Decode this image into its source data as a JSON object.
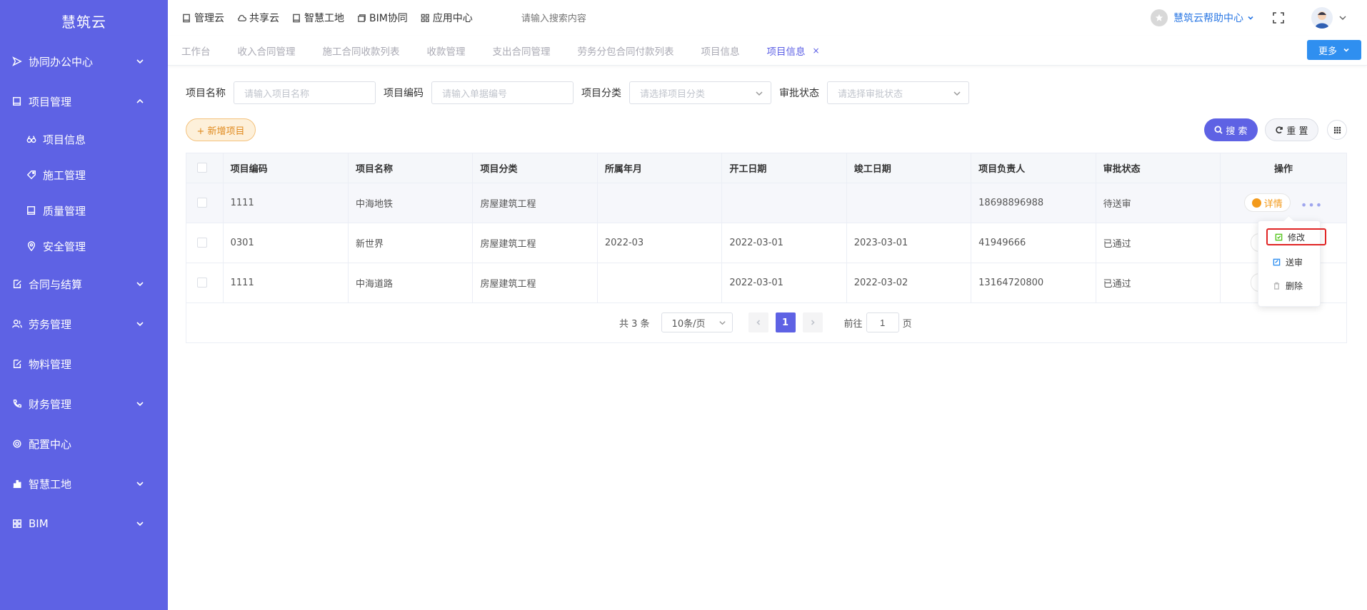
{
  "app": {
    "name": "慧筑云"
  },
  "sidebar": {
    "items": [
      {
        "label": "协同办公中心",
        "icon": "send-icon",
        "expandable": true,
        "expanded": false
      },
      {
        "label": "项目管理",
        "icon": "book-icon",
        "expandable": true,
        "expanded": true,
        "children": [
          {
            "label": "项目信息",
            "icon": "binoculars-icon"
          },
          {
            "label": "施工管理",
            "icon": "tag-icon"
          },
          {
            "label": "质量管理",
            "icon": "book-icon"
          },
          {
            "label": "安全管理",
            "icon": "location-icon"
          }
        ]
      },
      {
        "label": "合同与结算",
        "icon": "edit-icon",
        "expandable": true,
        "expanded": false
      },
      {
        "label": "劳务管理",
        "icon": "users-icon",
        "expandable": true,
        "expanded": false
      },
      {
        "label": "物料管理",
        "icon": "edit-icon",
        "expandable": false
      },
      {
        "label": "财务管理",
        "icon": "phone-icon",
        "expandable": true,
        "expanded": false
      },
      {
        "label": "配置中心",
        "icon": "gear-icon",
        "expandable": false
      },
      {
        "label": "智慧工地",
        "icon": "bar-chart-icon",
        "expandable": true,
        "expanded": false
      },
      {
        "label": "BIM",
        "icon": "grid-icon",
        "expandable": true,
        "expanded": false
      }
    ]
  },
  "topnav": {
    "items": [
      {
        "label": "管理云",
        "icon": "book-icon"
      },
      {
        "label": "共享云",
        "icon": "cloud-icon"
      },
      {
        "label": "智慧工地",
        "icon": "book-icon"
      },
      {
        "label": "BIM协同",
        "icon": "cube-icon"
      },
      {
        "label": "应用中心",
        "icon": "apps-icon"
      }
    ],
    "search_placeholder": "请输入搜索内容",
    "help_label": "慧筑云帮助中心"
  },
  "tabs": {
    "items": [
      "工作台",
      "收入合同管理",
      "施工合同收款列表",
      "收款管理",
      "支出合同管理",
      "劳务分包合同付款列表",
      "项目信息"
    ],
    "active": "项目信息",
    "close_symbol": "×",
    "more_label": "更多"
  },
  "filters": {
    "project_name": {
      "label": "项目名称",
      "placeholder": "请输入项目名称"
    },
    "project_code": {
      "label": "项目编码",
      "placeholder": "请输入单据编号"
    },
    "project_category": {
      "label": "项目分类",
      "placeholder": "请选择项目分类"
    },
    "approval_status": {
      "label": "审批状态",
      "placeholder": "请选择审批状态"
    }
  },
  "toolbar": {
    "add_label": "+ 新增项目",
    "search_label": "搜 索",
    "reset_label": "重 置"
  },
  "table": {
    "columns": [
      "项目编码",
      "项目名称",
      "项目分类",
      "所属年月",
      "开工日期",
      "竣工日期",
      "项目负责人",
      "审批状态",
      "操作"
    ],
    "rows": [
      {
        "code": "1111",
        "name": "中海地铁",
        "category": "房屋建筑工程",
        "month": "",
        "start": "",
        "end": "",
        "owner": "18698896988",
        "status": "待送审"
      },
      {
        "code": "0301",
        "name": "新世界",
        "category": "房屋建筑工程",
        "month": "2022-03",
        "start": "2022-03-01",
        "end": "2023-03-01",
        "owner": "41949666",
        "status": "已通过"
      },
      {
        "code": "1111",
        "name": "中海道路",
        "category": "房屋建筑工程",
        "month": "",
        "start": "2022-03-01",
        "end": "2022-03-02",
        "owner": "13164720800",
        "status": "已通过"
      }
    ],
    "detail_label": "详情",
    "more_dots": "•••"
  },
  "dropdown": {
    "items": [
      {
        "label": "修改",
        "icon": "edit-icon",
        "color": "#52c41a"
      },
      {
        "label": "送审",
        "icon": "send-doc-icon",
        "color": "#2f8ff0"
      },
      {
        "label": "删除",
        "icon": "trash-icon",
        "color": "#bbbbbb"
      }
    ]
  },
  "pagination": {
    "total_text": "共 3 条",
    "page_size": "10条/页",
    "current_page": "1",
    "goto_label": "前往",
    "goto_value": "1",
    "page_suffix": "页"
  },
  "colors": {
    "sidebar_bg": "#5e62e4",
    "accent": "#5e62e4",
    "more_button": "#2f8ff0",
    "add_button_text": "#e08a1e",
    "highlight_border": "#e02424"
  }
}
